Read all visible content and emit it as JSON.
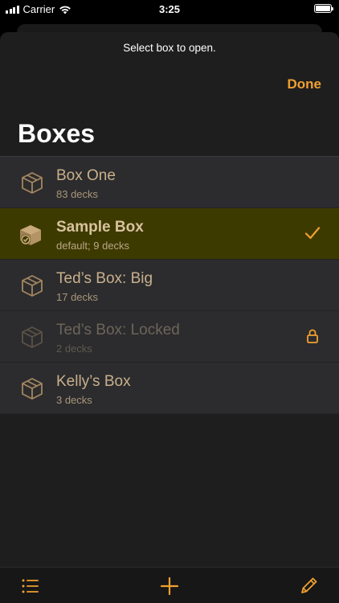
{
  "status_bar": {
    "carrier": "Carrier",
    "time": "3:25"
  },
  "sheet": {
    "prompt": "Select box to open.",
    "done_label": "Done",
    "title": "Boxes"
  },
  "boxes": [
    {
      "name": "Box One",
      "subtitle": "83 decks",
      "state": "normal"
    },
    {
      "name": "Sample Box",
      "subtitle": "default; 9 decks",
      "state": "selected"
    },
    {
      "name": "Ted’s Box: Big",
      "subtitle": "17 decks",
      "state": "normal"
    },
    {
      "name": "Ted’s Box: Locked",
      "subtitle": "2 decks",
      "state": "locked"
    },
    {
      "name": "Kelly’s Box",
      "subtitle": "3 decks",
      "state": "normal"
    }
  ],
  "toolbar": {
    "left_icon": "list-icon",
    "center_icon": "plus-icon",
    "right_icon": "pencil-icon"
  },
  "colors": {
    "accent": "#f0a030",
    "selected_row": "#3d3a00",
    "row_bg": "#2c2c2e",
    "sheet_bg": "#1e1e1f"
  }
}
